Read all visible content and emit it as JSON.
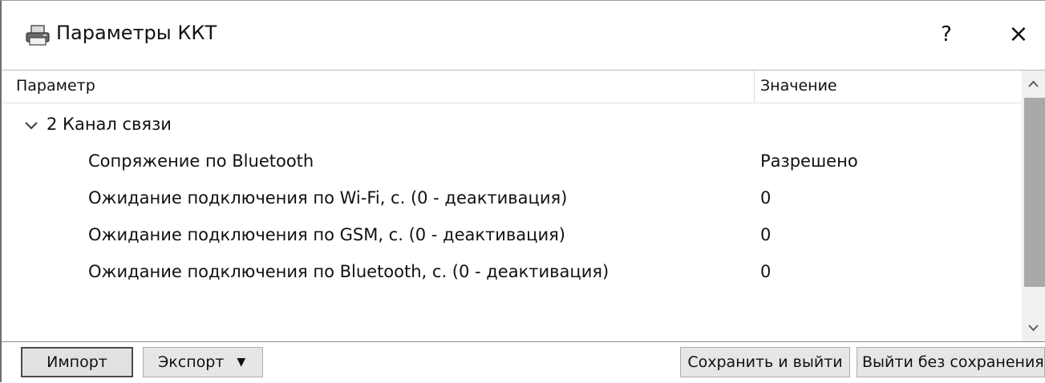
{
  "window": {
    "title": "Параметры ККТ",
    "help_label": "?",
    "close_label": "×"
  },
  "tree": {
    "columns": [
      "Параметр",
      "Значение"
    ],
    "group": {
      "label": "2 Канал связи",
      "expanded": true
    },
    "rows": [
      {
        "name": "Сопряжение по Bluetooth",
        "value": "Разрешено"
      },
      {
        "name": "Ожидание подключения по Wi-Fi, с. (0 - деактивация)",
        "value": "0"
      },
      {
        "name": "Ожидание подключения по GSM, с. (0 - деактивация)",
        "value": "0"
      },
      {
        "name": "Ожидание подключения по Bluetooth, с. (0 - деактивация)",
        "value": "0"
      }
    ]
  },
  "footer": {
    "import_label": "Импорт",
    "export_label": "Экспорт",
    "save_exit_label": "Сохранить и выйти",
    "exit_nosave_label": "Выйти без сохранения"
  },
  "icons": {
    "app": "printer-icon",
    "group_toggle": "chevron-down-icon",
    "scroll_up": "chevron-up-icon",
    "scroll_down": "chevron-down-icon",
    "export_menu": "caret-down-icon"
  }
}
